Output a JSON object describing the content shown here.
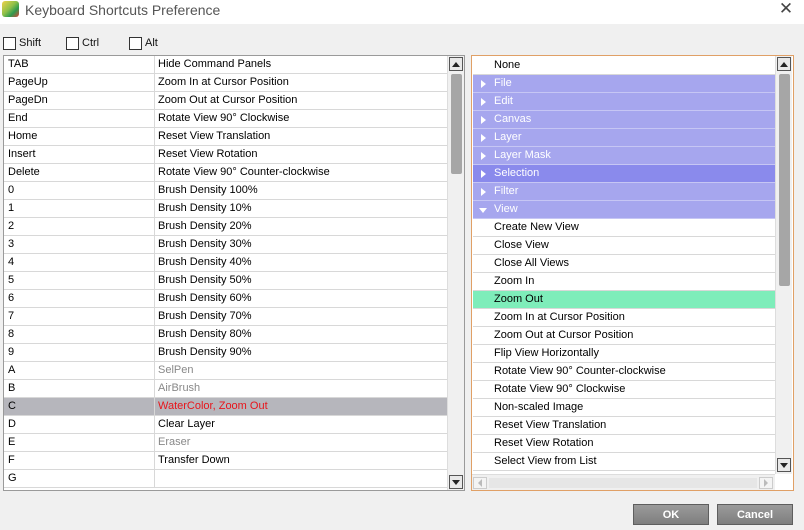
{
  "window": {
    "title": "Keyboard Shortcuts Preference",
    "close_glyph": "✕",
    "icon": "app-icon"
  },
  "modifiers": [
    {
      "label": "Shift",
      "checked": false
    },
    {
      "label": "Ctrl",
      "checked": false
    },
    {
      "label": "Alt",
      "checked": false
    }
  ],
  "shortcuts": [
    {
      "key": "TAB",
      "command": "Hide Command Panels",
      "gray": false
    },
    {
      "key": "PageUp",
      "command": "Zoom In at Cursor Position",
      "gray": false
    },
    {
      "key": "PageDn",
      "command": "Zoom Out at Cursor Position",
      "gray": false
    },
    {
      "key": "End",
      "command": "Rotate View 90° Clockwise",
      "gray": false
    },
    {
      "key": "Home",
      "command": "Reset View Translation",
      "gray": false
    },
    {
      "key": "Insert",
      "command": "Reset View Rotation",
      "gray": false
    },
    {
      "key": "Delete",
      "command": "Rotate View 90° Counter-clockwise",
      "gray": false
    },
    {
      "key": "0",
      "command": "Brush Density 100%",
      "gray": false
    },
    {
      "key": "1",
      "command": "Brush Density 10%",
      "gray": false
    },
    {
      "key": "2",
      "command": "Brush Density 20%",
      "gray": false
    },
    {
      "key": "3",
      "command": "Brush Density 30%",
      "gray": false
    },
    {
      "key": "4",
      "command": "Brush Density 40%",
      "gray": false
    },
    {
      "key": "5",
      "command": "Brush Density 50%",
      "gray": false
    },
    {
      "key": "6",
      "command": "Brush Density 60%",
      "gray": false
    },
    {
      "key": "7",
      "command": "Brush Density 70%",
      "gray": false
    },
    {
      "key": "8",
      "command": "Brush Density 80%",
      "gray": false
    },
    {
      "key": "9",
      "command": "Brush Density 90%",
      "gray": false
    },
    {
      "key": "A",
      "command": "SelPen",
      "gray": true
    },
    {
      "key": "B",
      "command": "AirBrush",
      "gray": true
    },
    {
      "key": "C",
      "command": "WaterColor, Zoom Out",
      "gray": false,
      "selected": true
    },
    {
      "key": "D",
      "command": "Clear Layer",
      "gray": false
    },
    {
      "key": "E",
      "command": "Eraser",
      "gray": true
    },
    {
      "key": "F",
      "command": "Transfer Down",
      "gray": false
    },
    {
      "key": "G",
      "command": "",
      "gray": false
    }
  ],
  "tree": [
    {
      "label": "None",
      "type": "none"
    },
    {
      "label": "File",
      "type": "category",
      "expanded": false
    },
    {
      "label": "Edit",
      "type": "category",
      "expanded": false
    },
    {
      "label": "Canvas",
      "type": "category",
      "expanded": false
    },
    {
      "label": "Layer",
      "type": "category",
      "expanded": false
    },
    {
      "label": "Layer Mask",
      "type": "category",
      "expanded": false
    },
    {
      "label": "Selection",
      "type": "category",
      "expanded": false,
      "selected": true
    },
    {
      "label": "Filter",
      "type": "category",
      "expanded": false
    },
    {
      "label": "View",
      "type": "category",
      "expanded": true
    },
    {
      "label": "Create New View",
      "type": "command"
    },
    {
      "label": "Close View",
      "type": "command"
    },
    {
      "label": "Close All Views",
      "type": "command"
    },
    {
      "label": "Zoom In",
      "type": "command"
    },
    {
      "label": "Zoom Out",
      "type": "command",
      "highlighted": true
    },
    {
      "label": "Zoom In at Cursor Position",
      "type": "command"
    },
    {
      "label": "Zoom Out at Cursor Position",
      "type": "command"
    },
    {
      "label": "Flip View Horizontally",
      "type": "command"
    },
    {
      "label": "Rotate View 90° Counter-clockwise",
      "type": "command"
    },
    {
      "label": "Rotate View 90° Clockwise",
      "type": "command"
    },
    {
      "label": "Non-scaled Image",
      "type": "command"
    },
    {
      "label": "Reset View Translation",
      "type": "command"
    },
    {
      "label": "Reset View Rotation",
      "type": "command"
    },
    {
      "label": "Select View from List",
      "type": "command"
    }
  ],
  "buttons": {
    "ok": "OK",
    "cancel": "Cancel"
  },
  "colors": {
    "category_bg": "#a6a6ee",
    "category_selected_bg": "#8a8aec",
    "highlight_bg": "#7eedba",
    "selected_row_bg": "#b6b6bc",
    "selected_row_text": "#e8151b",
    "right_panel_border": "#e0a066"
  }
}
